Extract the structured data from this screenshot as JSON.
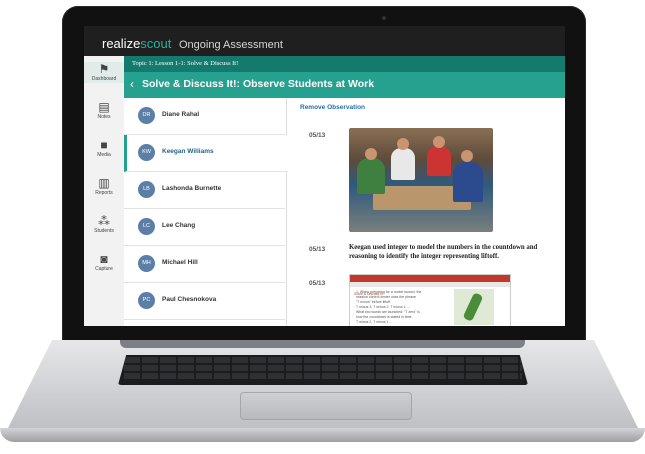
{
  "app": {
    "brand_realize": "realize",
    "brand_scout": "scout",
    "module_title": "Ongoing Assessment"
  },
  "nav": [
    {
      "label": "Dashboard",
      "icon": "pin-icon"
    },
    {
      "label": "Notes",
      "icon": "note-icon"
    },
    {
      "label": "Media",
      "icon": "briefcase-icon"
    },
    {
      "label": "Reports",
      "icon": "bar-chart-icon"
    },
    {
      "label": "Students",
      "icon": "group-icon"
    },
    {
      "label": "Capture",
      "icon": "camera-icon"
    }
  ],
  "breadcrumb": "Topic 1: Lesson 1-1: Solve & Discuss It!",
  "header": {
    "back_icon": "chevron-left-icon",
    "title": "Solve & Discuss It!: Observe Students at Work"
  },
  "students": [
    {
      "initials": "DR",
      "name": "Diane Rahal",
      "active": false
    },
    {
      "initials": "KW",
      "name": "Keegan Williams",
      "active": true
    },
    {
      "initials": "LB",
      "name": "Lashonda Burnette",
      "active": false
    },
    {
      "initials": "LC",
      "name": "Lee Chang",
      "active": false
    },
    {
      "initials": "MH",
      "name": "Michael Hill",
      "active": false
    },
    {
      "initials": "PC",
      "name": "Paul Chesnokova",
      "active": false
    }
  ],
  "content": {
    "remove_label": "Remove Observation",
    "observations": [
      {
        "date": "05/13"
      },
      {
        "date": "05/13",
        "note": "Keegan used integer to model the numbers in the countdown and reasoning to identify the integer representing liftoff."
      },
      {
        "date": "05/13"
      }
    ],
    "thumb_title": "Solve & Discuss It!",
    "thumb_lines": [
      "1. When preparing for a rocket launch, the",
      "   mission control center uses the phrase",
      "   \"T minus\" before liftoff.",
      "   T minus 3, T minus 2, T minus 1 ...",
      "   What two words are launched: \"T zero\" is",
      "   how the countdown is stated in time.",
      "   T minus 2, T minus 1 ..."
    ]
  }
}
